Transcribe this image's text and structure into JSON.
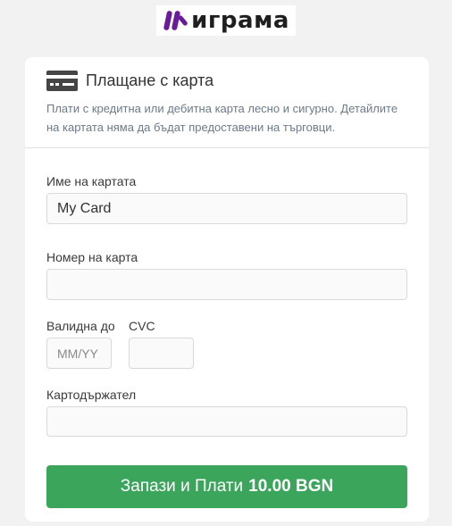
{
  "logo": {
    "text": "играма",
    "brand_color": "#6a1b9a"
  },
  "payment": {
    "title": "Плащане с карта",
    "description": "Плати с кредитна или дебитна карта лесно и сигурно. Детайлите на картата няма да бъдат предоставени на търговци."
  },
  "form": {
    "card_name": {
      "label": "Име на картата",
      "value": "My Card",
      "placeholder": ""
    },
    "card_number": {
      "label": "Номер на карта",
      "value": "",
      "placeholder": ""
    },
    "expiry": {
      "label": "Валидна до",
      "value": "",
      "placeholder": "MM/YY"
    },
    "cvc": {
      "label": "CVC",
      "value": "",
      "placeholder": ""
    },
    "holder": {
      "label": "Картодържател",
      "value": "",
      "placeholder": ""
    }
  },
  "submit": {
    "label": "Запази и Плати",
    "amount": "10.00 BGN",
    "color": "#3aa55b"
  },
  "icons": [
    "credit-card-icon",
    "igrama-logo-icon"
  ]
}
